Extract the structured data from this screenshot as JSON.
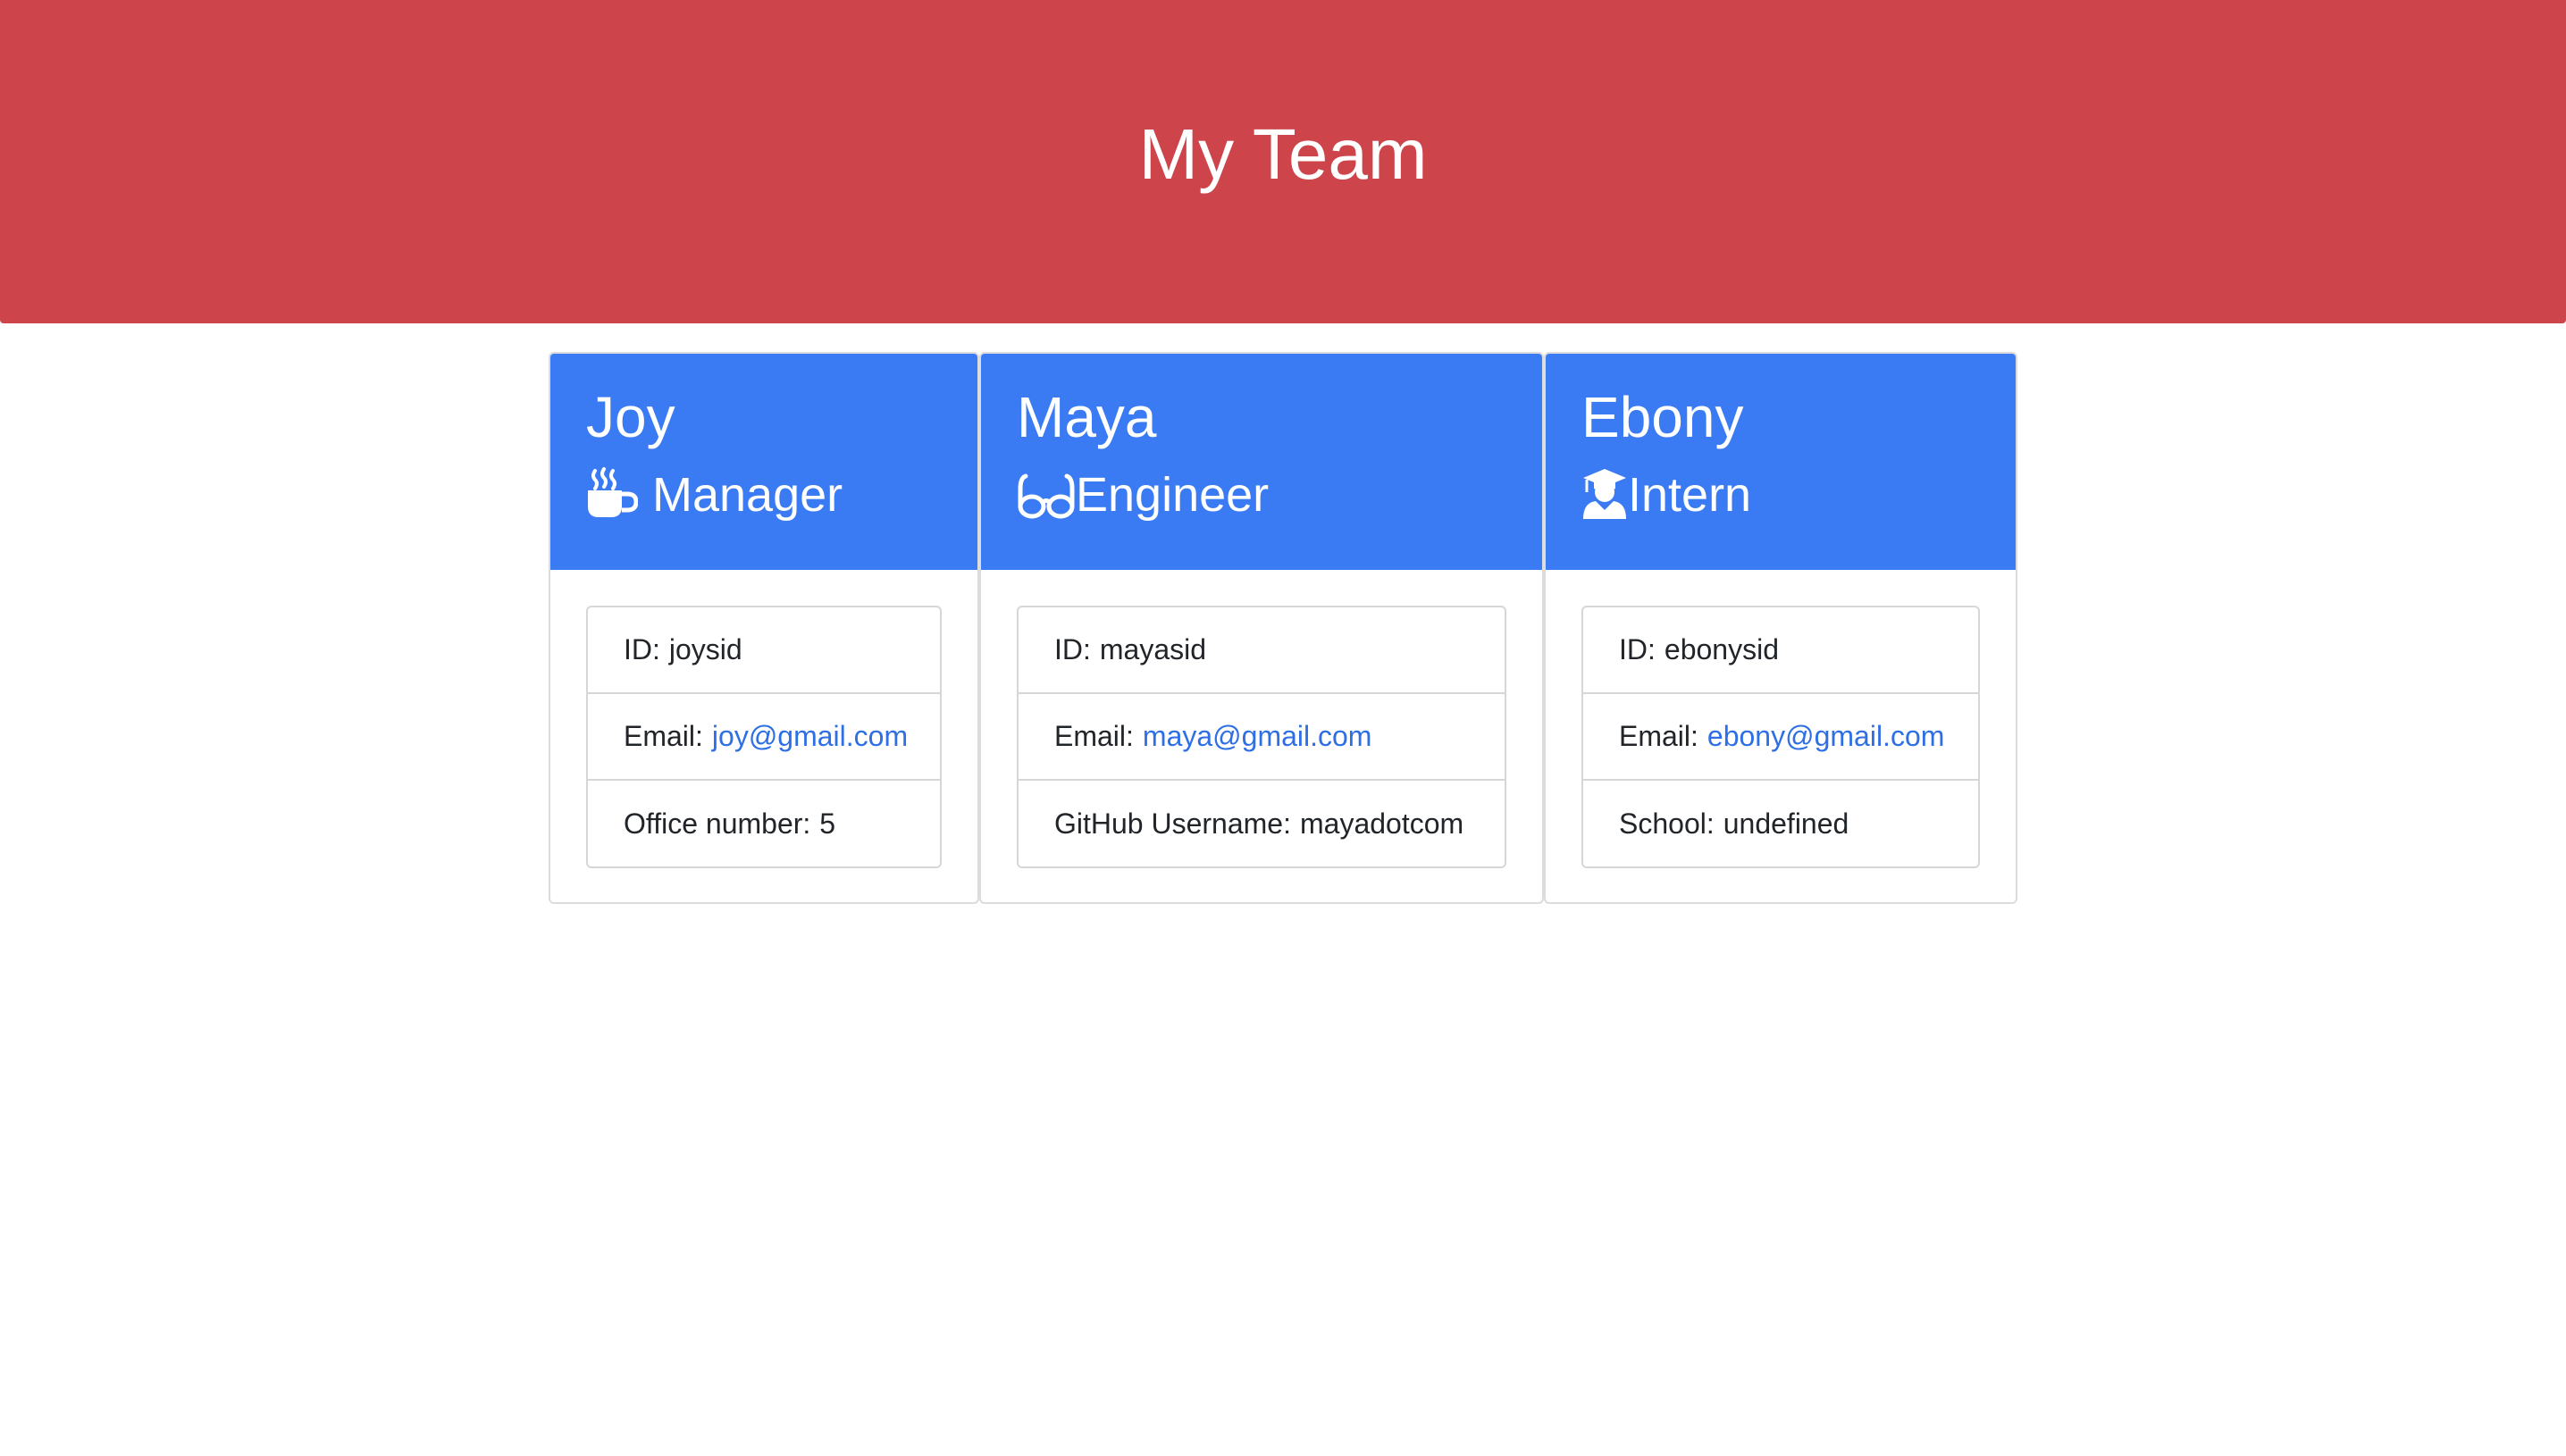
{
  "header": {
    "title": "My Team"
  },
  "colors": {
    "header_bg": "#cd444b",
    "card_header_bg": "#3a7bf3",
    "link": "#2f6fe4"
  },
  "employees": [
    {
      "name": "Joy",
      "role": "Manager",
      "icon": "coffee-mug-icon",
      "id_label": "ID:",
      "id_value": "joysid",
      "email_label": "Email:",
      "email": "joy@gmail.com",
      "extra_label": "Office number:",
      "extra_value": "5"
    },
    {
      "name": "Maya",
      "role": "Engineer",
      "icon": "glasses-icon",
      "id_label": "ID:",
      "id_value": "mayasid",
      "email_label": "Email:",
      "email": "maya@gmail.com",
      "extra_label": "GitHub Username:",
      "extra_value": "mayadotcom"
    },
    {
      "name": "Ebony",
      "role": "Intern",
      "icon": "graduate-icon",
      "id_label": "ID:",
      "id_value": "ebonysid",
      "email_label": "Email:",
      "email": "ebony@gmail.com",
      "extra_label": "School:",
      "extra_value": "undefined"
    }
  ]
}
